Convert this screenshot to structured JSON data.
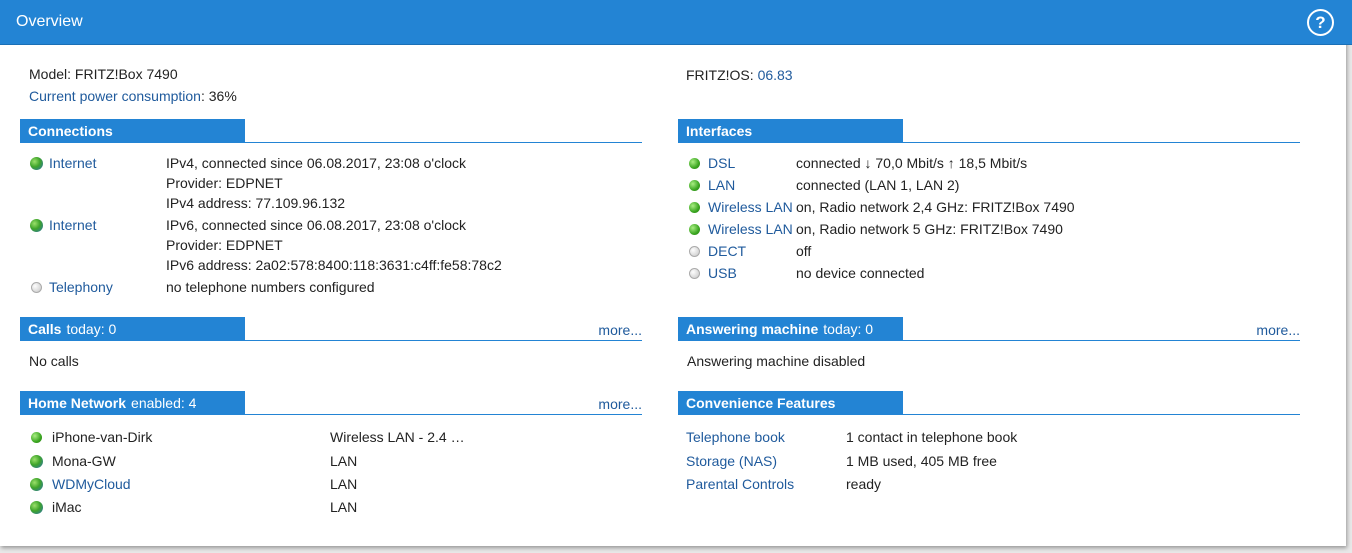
{
  "header": {
    "title": "Overview",
    "help_label": "?"
  },
  "info": {
    "model_label": "Model: FRITZ!Box 7490",
    "power_link": "Current power consumption",
    "power_value": ": 36%",
    "os_label": "FRITZ!OS: ",
    "os_version": "06.83"
  },
  "connections": {
    "title": "Connections",
    "items": [
      {
        "name": "Internet",
        "lines": [
          "IPv4, connected since 06.08.2017, 23:08 o'clock",
          "Provider: EDPNET",
          "IPv4 address: 77.109.96.132"
        ],
        "icon": "globe-icon"
      },
      {
        "name": "Internet",
        "lines": [
          "IPv6, connected since 06.08.2017, 23:08 o'clock",
          "Provider: EDPNET",
          "IPv6 address: 2a02:578:8400:118:3631:c4ff:fe58:78c2"
        ],
        "icon": "globe-icon"
      },
      {
        "name": "Telephony",
        "lines": [
          "no telephone numbers configured"
        ],
        "icon": "status-off-icon"
      }
    ]
  },
  "interfaces": {
    "title": "Interfaces",
    "items": [
      {
        "name": "DSL",
        "status": "connected ↓ 70,0 Mbit/s ↑ 18,5 Mbit/s",
        "active": true
      },
      {
        "name": "LAN",
        "status": "connected (LAN 1, LAN 2)",
        "active": true
      },
      {
        "name": "Wireless LAN",
        "status": "on, Radio network 2,4 GHz: FRITZ!Box 7490",
        "active": true
      },
      {
        "name": "Wireless LAN",
        "status": "on, Radio network 5 GHz: FRITZ!Box 7490",
        "active": true
      },
      {
        "name": "DECT",
        "status": "off",
        "active": false
      },
      {
        "name": "USB",
        "status": "no device connected",
        "active": false
      }
    ]
  },
  "calls": {
    "title": "Calls",
    "sub": "today: 0",
    "more": "more...",
    "body": "No calls"
  },
  "answering": {
    "title": "Answering machine",
    "sub": "today: 0",
    "more": "more...",
    "body": "Answering machine disabled"
  },
  "home_network": {
    "title": "Home Network",
    "sub": "enabled: 4",
    "more": "more...",
    "devices": [
      {
        "name": "iPhone-van-Dirk",
        "conn": "Wireless LAN - 2.4 …",
        "icon": "status-on-icon",
        "link": false
      },
      {
        "name": "Mona-GW",
        "conn": "LAN",
        "icon": "globe-icon",
        "link": false
      },
      {
        "name": "WDMyCloud",
        "conn": "LAN",
        "icon": "globe-icon",
        "link": true
      },
      {
        "name": "iMac",
        "conn": "LAN",
        "icon": "globe-icon",
        "link": false
      }
    ]
  },
  "convenience": {
    "title": "Convenience Features",
    "items": [
      {
        "name": "Telephone book",
        "value": "1 contact in telephone book"
      },
      {
        "name": "Storage (NAS)",
        "value": "1 MB used, 405 MB free"
      },
      {
        "name": "Parental Controls",
        "value": "ready"
      }
    ]
  }
}
